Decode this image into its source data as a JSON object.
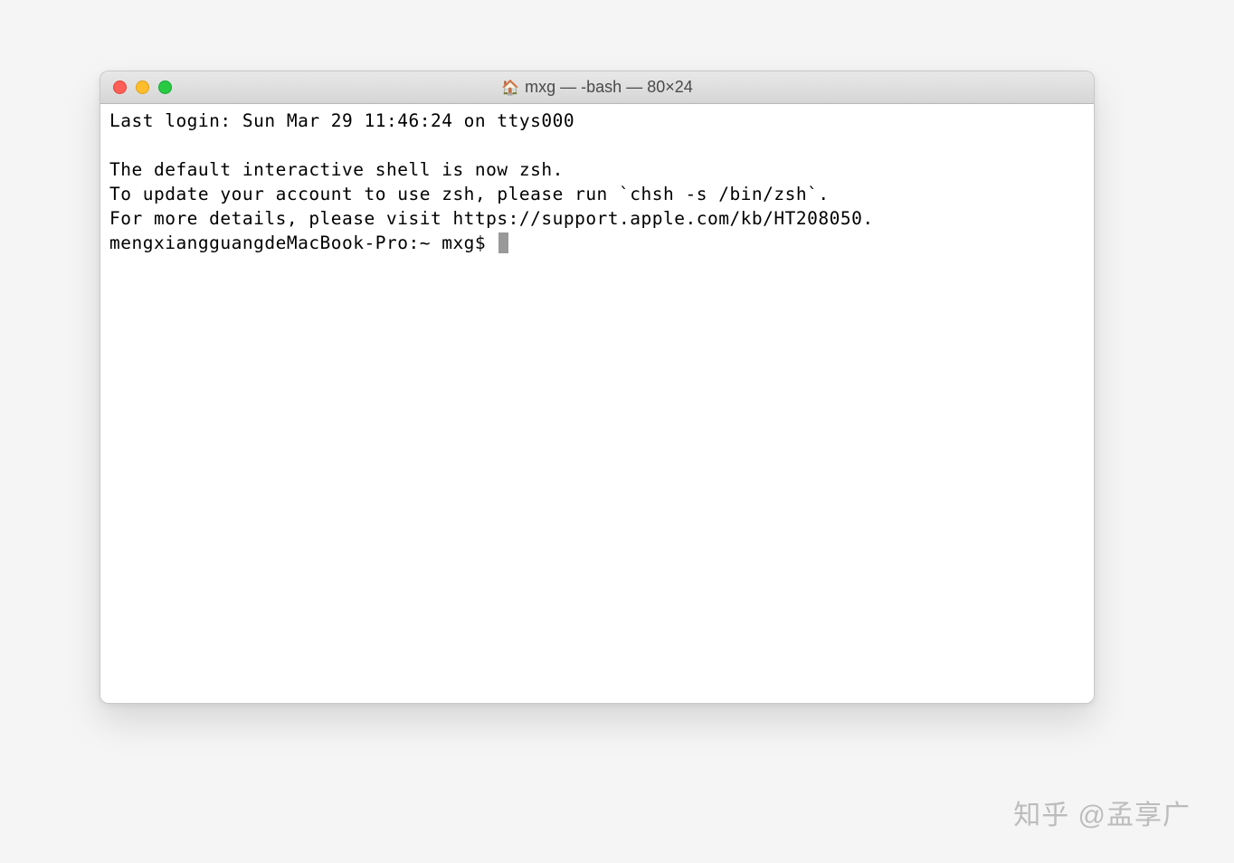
{
  "window": {
    "title": "mxg — -bash — 80×24",
    "icon": "🏠"
  },
  "terminal": {
    "lines": [
      "Last login: Sun Mar 29 11:46:24 on ttys000",
      "",
      "The default interactive shell is now zsh.",
      "To update your account to use zsh, please run `chsh -s /bin/zsh`.",
      "For more details, please visit https://support.apple.com/kb/HT208050."
    ],
    "prompt": "mengxiangguangdeMacBook-Pro:~ mxg$ "
  },
  "watermark": "知乎 @孟享广"
}
